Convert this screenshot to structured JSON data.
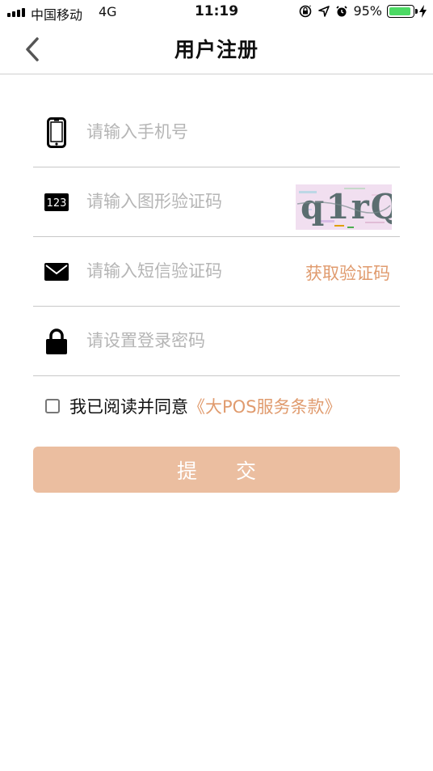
{
  "status_bar": {
    "carrier": "中国移动",
    "network": "4G",
    "time": "11:19",
    "battery_percent": "95%",
    "battery_level": 0.95,
    "icons": [
      "signal-icon",
      "orientation-lock-icon",
      "location-icon",
      "alarm-icon",
      "battery-icon",
      "charging-icon"
    ]
  },
  "nav": {
    "title": "用户注册",
    "back_icon": "chevron-left-icon"
  },
  "form": {
    "phone": {
      "placeholder": "请输入手机号",
      "icon": "phone-icon"
    },
    "captcha": {
      "placeholder": "请输入图形验证码",
      "icon": "number-123-icon",
      "image_text": "q1rQ"
    },
    "sms": {
      "placeholder": "请输入短信验证码",
      "icon": "mail-icon",
      "button_label": "获取验证码"
    },
    "password": {
      "placeholder": "请设置登录密码",
      "icon": "lock-icon"
    }
  },
  "agreement": {
    "text": "我已阅读并同意",
    "link": "《大POS服务条款》"
  },
  "submit_label": "提 交",
  "colors": {
    "accent": "#e09b6e",
    "button_bg": "#ebbea0",
    "battery_green": "#4cd964",
    "divider": "#c8c8c8"
  }
}
